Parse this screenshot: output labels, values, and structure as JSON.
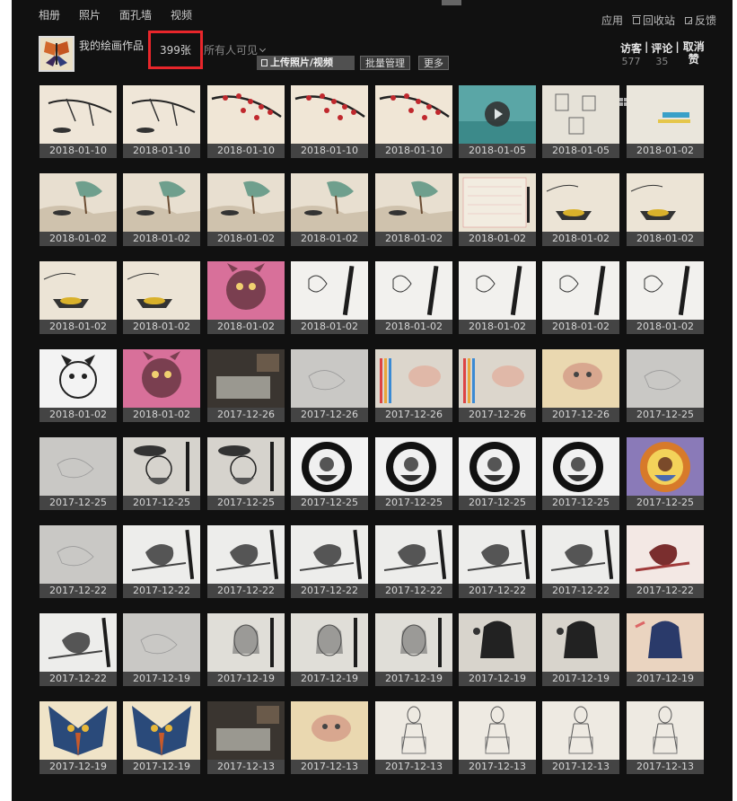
{
  "nav": {
    "items": [
      "相册",
      "照片",
      "面孔墙",
      "视频"
    ]
  },
  "topright": {
    "apps": "应用",
    "recycle": "回收站",
    "feedback": "反馈"
  },
  "album": {
    "title": "我的绘画作品",
    "count": "399张",
    "visibility": "所有人可见"
  },
  "toolbar": {
    "upload": "上传照片/视频",
    "batch": "批量管理",
    "more": "更多"
  },
  "stats": {
    "visitors_label": "访客",
    "visitors_value": "577",
    "comments_label": "评论",
    "comments_value": "35",
    "cancel_like": "取消赞"
  },
  "colors": {
    "panel_bg": "#111111",
    "caption_bg": "#444444",
    "highlight": "#e8262b"
  },
  "photos": [
    {
      "date": "2018-01-10",
      "kind": "branch"
    },
    {
      "date": "2018-01-10",
      "kind": "branch"
    },
    {
      "date": "2018-01-10",
      "kind": "plum"
    },
    {
      "date": "2018-01-10",
      "kind": "plum"
    },
    {
      "date": "2018-01-10",
      "kind": "plum"
    },
    {
      "date": "2018-01-05",
      "kind": "video"
    },
    {
      "date": "2018-01-05",
      "kind": "doodle"
    },
    {
      "date": "2018-01-02",
      "kind": "sketchcolor"
    },
    {
      "date": "2018-01-02",
      "kind": "landscape"
    },
    {
      "date": "2018-01-02",
      "kind": "landscape"
    },
    {
      "date": "2018-01-02",
      "kind": "landscape"
    },
    {
      "date": "2018-01-02",
      "kind": "landscape"
    },
    {
      "date": "2018-01-02",
      "kind": "landscape"
    },
    {
      "date": "2018-01-02",
      "kind": "paper"
    },
    {
      "date": "2018-01-02",
      "kind": "boat"
    },
    {
      "date": "2018-01-02",
      "kind": "boat"
    },
    {
      "date": "2018-01-02",
      "kind": "boat"
    },
    {
      "date": "2018-01-02",
      "kind": "boat"
    },
    {
      "date": "2018-01-02",
      "kind": "dogpink"
    },
    {
      "date": "2018-01-02",
      "kind": "pen"
    },
    {
      "date": "2018-01-02",
      "kind": "pen"
    },
    {
      "date": "2018-01-02",
      "kind": "pen"
    },
    {
      "date": "2018-01-02",
      "kind": "pen"
    },
    {
      "date": "2018-01-02",
      "kind": "pen"
    },
    {
      "date": "2018-01-02",
      "kind": "dogbw"
    },
    {
      "date": "2018-01-02",
      "kind": "dogpink"
    },
    {
      "date": "2017-12-26",
      "kind": "desk"
    },
    {
      "date": "2017-12-26",
      "kind": "gray"
    },
    {
      "date": "2017-12-26",
      "kind": "pencils"
    },
    {
      "date": "2017-12-26",
      "kind": "pencils"
    },
    {
      "date": "2017-12-26",
      "kind": "warm"
    },
    {
      "date": "2017-12-25",
      "kind": "gray"
    },
    {
      "date": "2017-12-25",
      "kind": "gray"
    },
    {
      "date": "2017-12-25",
      "kind": "santa"
    },
    {
      "date": "2017-12-25",
      "kind": "santa"
    },
    {
      "date": "2017-12-25",
      "kind": "santacircle"
    },
    {
      "date": "2017-12-25",
      "kind": "santacircle"
    },
    {
      "date": "2017-12-25",
      "kind": "santacircle"
    },
    {
      "date": "2017-12-25",
      "kind": "santacircle"
    },
    {
      "date": "2017-12-25",
      "kind": "santacolor"
    },
    {
      "date": "2017-12-22",
      "kind": "gray"
    },
    {
      "date": "2017-12-22",
      "kind": "bird"
    },
    {
      "date": "2017-12-22",
      "kind": "bird"
    },
    {
      "date": "2017-12-22",
      "kind": "bird"
    },
    {
      "date": "2017-12-22",
      "kind": "bird"
    },
    {
      "date": "2017-12-22",
      "kind": "bird"
    },
    {
      "date": "2017-12-22",
      "kind": "bird"
    },
    {
      "date": "2017-12-22",
      "kind": "birdcolor"
    },
    {
      "date": "2017-12-22",
      "kind": "bird"
    },
    {
      "date": "2017-12-19",
      "kind": "gray"
    },
    {
      "date": "2017-12-19",
      "kind": "portrait"
    },
    {
      "date": "2017-12-19",
      "kind": "portrait"
    },
    {
      "date": "2017-12-19",
      "kind": "portrait"
    },
    {
      "date": "2017-12-19",
      "kind": "portraitdark"
    },
    {
      "date": "2017-12-19",
      "kind": "portraitdark"
    },
    {
      "date": "2017-12-19",
      "kind": "portraitcolor"
    },
    {
      "date": "2017-12-19",
      "kind": "elephant"
    },
    {
      "date": "2017-12-19",
      "kind": "elephant"
    },
    {
      "date": "2017-12-13",
      "kind": "desk"
    },
    {
      "date": "2017-12-13",
      "kind": "warm"
    },
    {
      "date": "2017-12-13",
      "kind": "figure"
    },
    {
      "date": "2017-12-13",
      "kind": "figure"
    },
    {
      "date": "2017-12-13",
      "kind": "figure"
    },
    {
      "date": "2017-12-13",
      "kind": "figure"
    }
  ]
}
